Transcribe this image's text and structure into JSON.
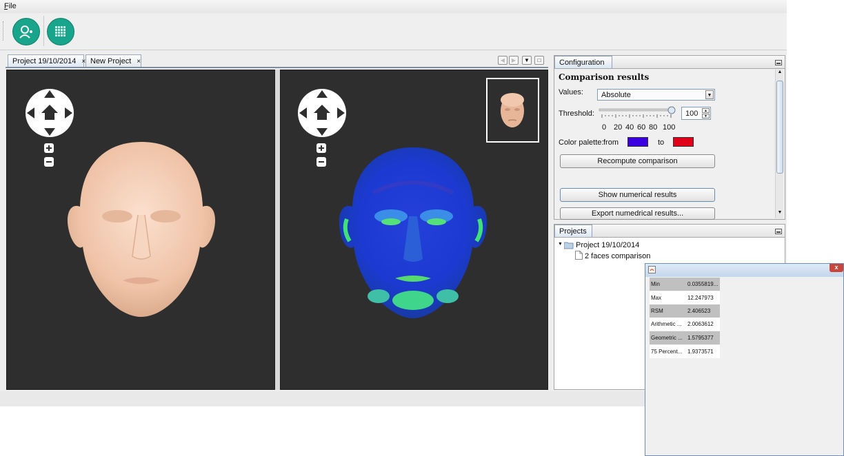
{
  "menubar": {
    "file_label": "File"
  },
  "toolbar": {
    "buttons": [
      {
        "icon": "add-face-icon"
      },
      {
        "icon": "batch-grid-icon"
      }
    ]
  },
  "tabs": [
    {
      "label": "Project 19/10/2014",
      "close": "×",
      "active": true
    },
    {
      "label": "New Project",
      "close": "×",
      "active": false
    }
  ],
  "configuration": {
    "tab_label": "Configuration",
    "section_title": "Comparison results",
    "values_label": "Values:",
    "values_selected": "Absolute",
    "threshold_label": "Threshold:",
    "threshold_value": "100",
    "threshold_fraction": 1.0,
    "scale_labels": [
      "0",
      "20",
      "40",
      "60",
      "80",
      "100"
    ],
    "palette_label": "Color palette:",
    "palette_from_label": "from",
    "palette_to_label": "to",
    "palette_from_color": "#3b00e0",
    "palette_to_color": "#e00018",
    "recompute_label": "Recompute comparison",
    "show_numerical_label": "Show numerical results",
    "export_label": "Export numedrical results..."
  },
  "projects": {
    "tab_label": "Projects",
    "tree": {
      "root_label": "Project 19/10/2014",
      "child_label": "2 faces comparison"
    }
  },
  "results_window": {
    "close_label": "x",
    "rows": [
      {
        "key": "Min",
        "value": "0.0355819..."
      },
      {
        "key": "Max",
        "value": "12.247973"
      },
      {
        "key": "RSM",
        "value": "2.406523"
      },
      {
        "key": "Arithmetic ...",
        "value": "2.0063612"
      },
      {
        "key": "Geometric ...",
        "value": "1.5795377"
      },
      {
        "key": "75 Percent...",
        "value": "1.9373571"
      }
    ]
  },
  "colors": {
    "accent_teal": "#18a58b",
    "viewport_bg": "#2e2e2e",
    "skin": "#f2c9ad",
    "heatmap_blue": "#1e3fd6",
    "heatmap_green": "#22d860"
  }
}
